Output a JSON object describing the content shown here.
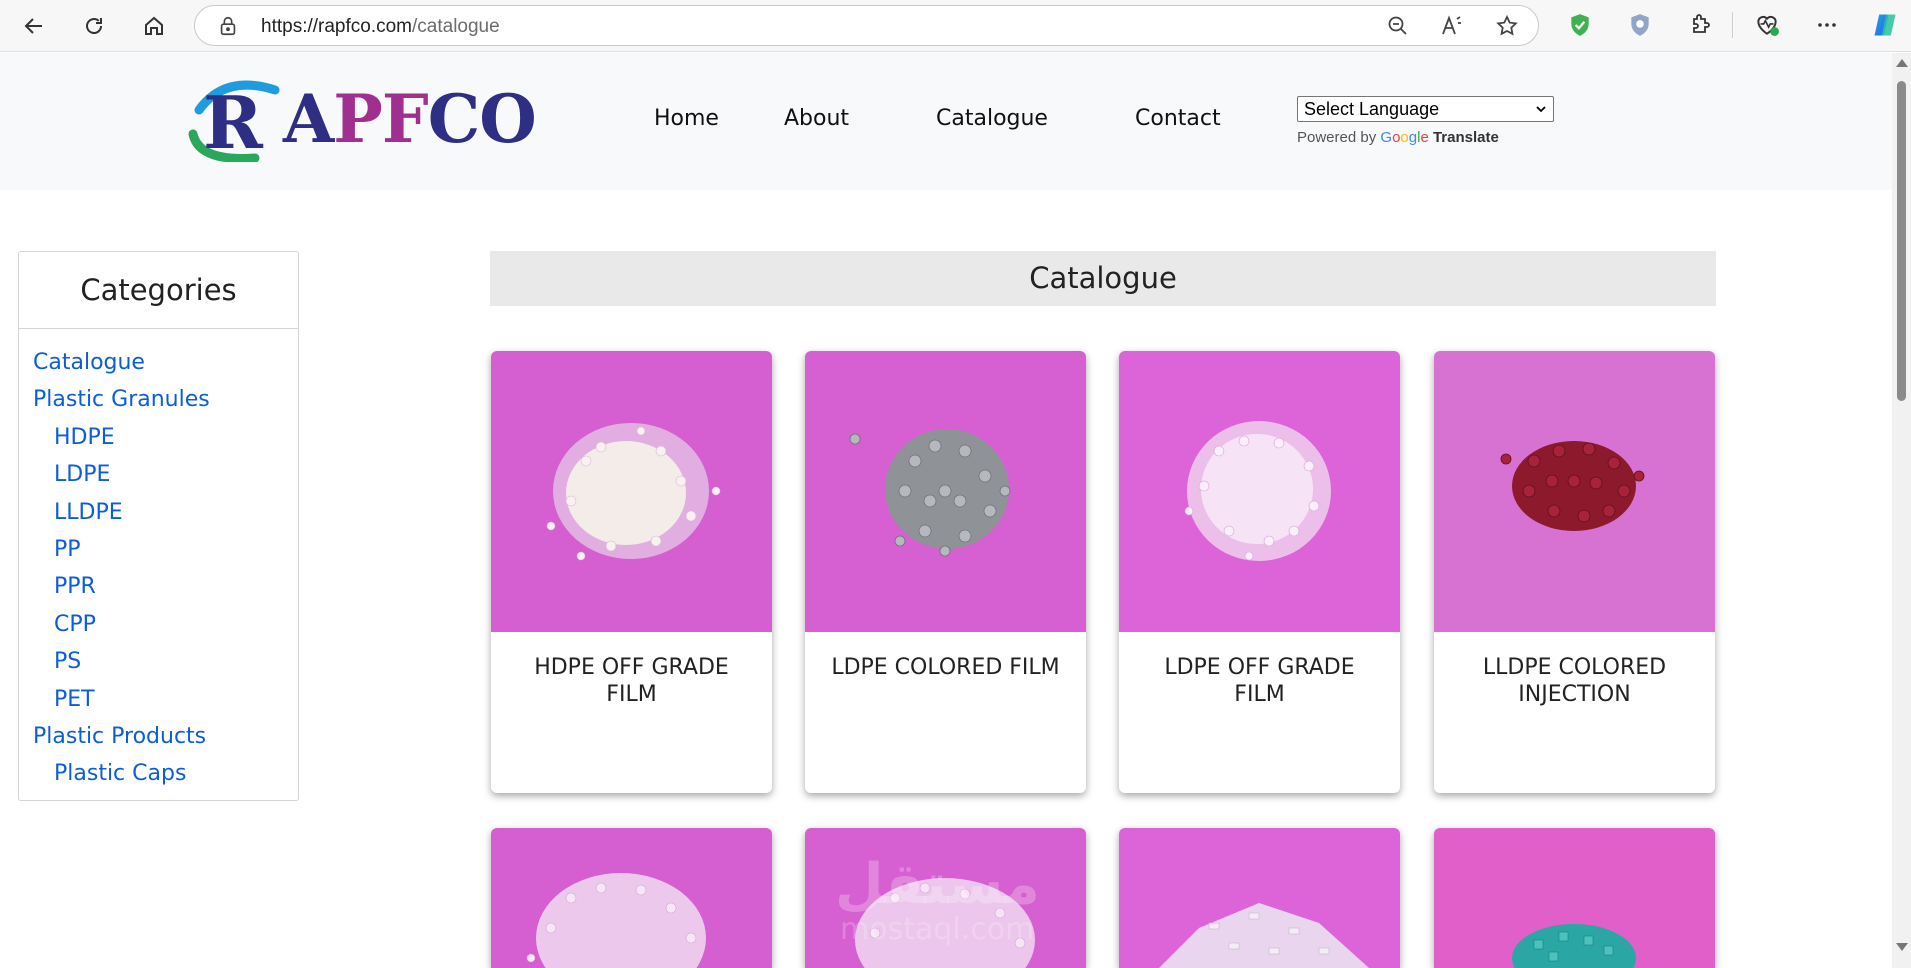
{
  "browser": {
    "url_host": "https://rapfco.com",
    "url_path": "/catalogue",
    "icons": [
      "back-icon",
      "reload-icon",
      "home-icon",
      "lock-icon",
      "zoom-out-icon",
      "read-aloud-icon",
      "favorite-star-icon",
      "shield-check-icon",
      "privacy-shield-icon",
      "extensions-icon",
      "health-heart-icon",
      "more-icon",
      "copilot-icon"
    ]
  },
  "header": {
    "logo_r": "R",
    "logo_text_a": "A",
    "logo_text_pf": "PF",
    "logo_text_co": "CO",
    "nav": [
      "Home",
      "About",
      "Catalogue",
      "Contact"
    ],
    "language_select": "Select Language",
    "powered_by": "Powered by",
    "google": [
      "G",
      "o",
      "o",
      "g",
      "l",
      "e"
    ],
    "translate": "Translate"
  },
  "sidebar": {
    "title": "Categories",
    "items": [
      {
        "label": "Catalogue",
        "level": 0
      },
      {
        "label": "Plastic Granules",
        "level": 0
      },
      {
        "label": "HDPE",
        "level": 1
      },
      {
        "label": "LDPE",
        "level": 1
      },
      {
        "label": "LLDPE",
        "level": 1
      },
      {
        "label": "PP",
        "level": 1
      },
      {
        "label": "PPR",
        "level": 1
      },
      {
        "label": "CPP",
        "level": 1
      },
      {
        "label": "PS",
        "level": 1
      },
      {
        "label": "PET",
        "level": 1
      },
      {
        "label": "Plastic Products",
        "level": 0
      },
      {
        "label": "Plastic Caps",
        "level": 1
      }
    ]
  },
  "catalogue": {
    "heading": "Catalogue",
    "products": [
      {
        "title_line1": "HDPE OFF GRADE",
        "title_line2": "FILM",
        "granule_color": "#f2e9ee",
        "bg_color": "#d55ed0"
      },
      {
        "title_line1": "LDPE COLORED FILM",
        "title_line2": "",
        "granule_color": "#9ea2a6",
        "bg_color": "#d65fd1"
      },
      {
        "title_line1": "LDPE OFF GRADE",
        "title_line2": "FILM",
        "granule_color": "#f6e2f8",
        "bg_color": "#dd63d8"
      },
      {
        "title_line1": "LLDPE COLORED",
        "title_line2": "INJECTION",
        "granule_color": "#8c1a2c",
        "bg_color": "#d872d2"
      }
    ],
    "second_row_granule_colors": [
      "#f3dcf3",
      "#f3dcf3",
      "#efe4f2",
      "#2aa7a4"
    ],
    "watermark": "مستقل",
    "watermark_sub": "mostaql.com"
  }
}
